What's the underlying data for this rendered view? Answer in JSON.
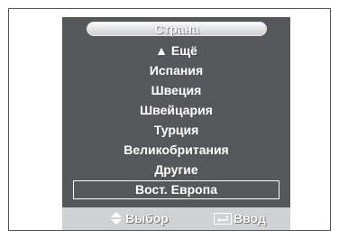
{
  "menu": {
    "title": "Страна",
    "items": [
      {
        "label": "▲ Ещё",
        "selected": false
      },
      {
        "label": "Испания",
        "selected": false
      },
      {
        "label": "Швеция",
        "selected": false
      },
      {
        "label": "Швейцария",
        "selected": false
      },
      {
        "label": "Турция",
        "selected": false
      },
      {
        "label": "Великобритания",
        "selected": false
      },
      {
        "label": "Другие",
        "selected": false
      },
      {
        "label": "Вост. Европа",
        "selected": true
      }
    ]
  },
  "footer": {
    "select_label": "Выбор",
    "enter_label": "Ввод",
    "select_icon": "up-down-arrows-icon",
    "enter_icon": "enter-key-icon"
  },
  "colors": {
    "panel": "#55585a",
    "footer": "#cfd2d4",
    "text": "#ffffff"
  }
}
